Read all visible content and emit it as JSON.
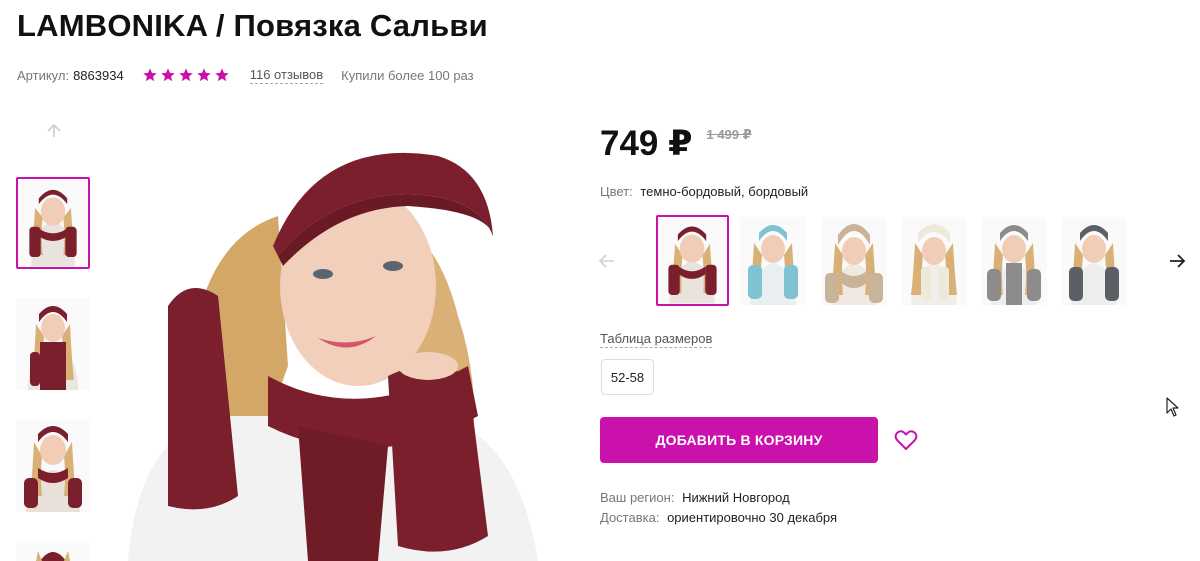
{
  "product": {
    "title": "LAMBONIKA / Повязка Сальви",
    "sku_label": "Артикул:",
    "sku_value": "8863934",
    "rating_stars": 5,
    "reviews": "116 отзывов",
    "bought": "Купили более 100 раз"
  },
  "price": {
    "current": "749 ₽",
    "old": "1 499 ₽"
  },
  "color": {
    "label": "Цвет:",
    "value": "темно-бордовый, бордовый"
  },
  "color_options": [
    {
      "name": "dark-burgundy",
      "hex": "#7a1f2b"
    },
    {
      "name": "light-blue",
      "hex": "#7fc3d2"
    },
    {
      "name": "beige",
      "hex": "#c9b49a"
    },
    {
      "name": "cream",
      "hex": "#efe9dc"
    },
    {
      "name": "gray",
      "hex": "#8c8c8c"
    },
    {
      "name": "dark-gray",
      "hex": "#5c6066"
    }
  ],
  "sizes": {
    "table_link": "Таблица размеров",
    "options": [
      "52-58"
    ]
  },
  "cart": {
    "add_label": "ДОБАВИТЬ В КОРЗИНУ"
  },
  "delivery": {
    "region_label": "Ваш регион:",
    "region_value": "Нижний Новгород",
    "delivery_label": "Доставка:",
    "delivery_value": "ориентировочно 30 декабря"
  },
  "colors": {
    "accent": "#cb11ab",
    "star": "#cb11ab",
    "text": "#111111",
    "muted": "#777777"
  }
}
